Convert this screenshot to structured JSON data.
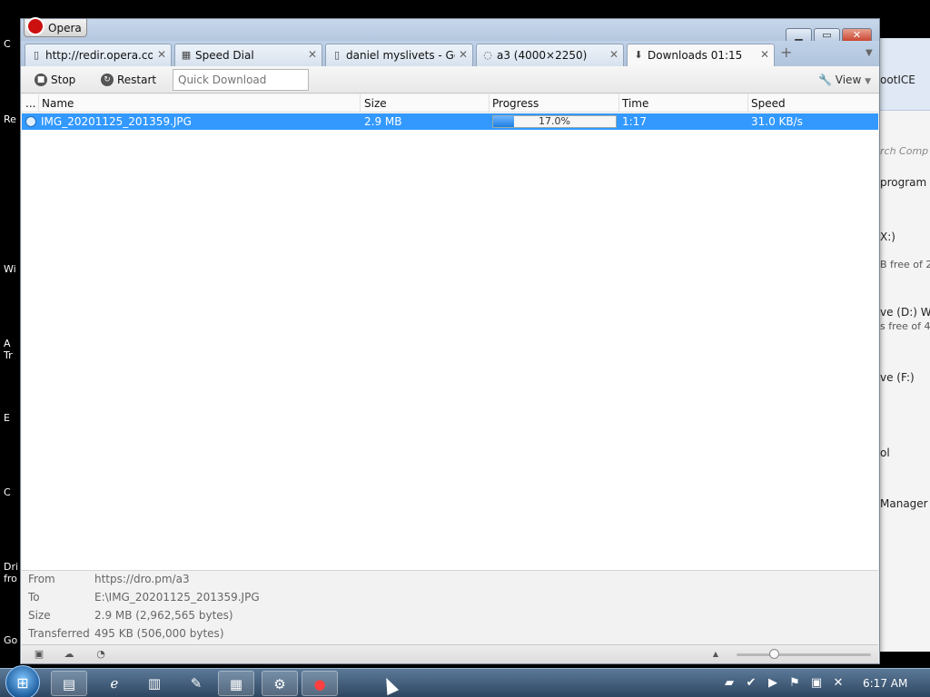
{
  "desktop": {
    "labels": [
      "C",
      "Re",
      "Wi",
      "A\nTr",
      "E",
      "C",
      "Dri\nfro",
      "Go"
    ]
  },
  "background_window": {
    "text1": "ootICE",
    "search_placeholder": "rch Comp",
    "program": "program",
    "drive1": "X:)",
    "drive1_free": "B free of 2",
    "drive2": "ve (D:) WI",
    "drive2_free": "s free of 46",
    "drive3": "ve (F:)",
    "item1": "ol",
    "item2": "Manager"
  },
  "window": {
    "app_name": "Opera",
    "colors": {
      "accent": "#3399ff",
      "close": "#c8402a"
    }
  },
  "tabs": [
    {
      "label": "http://redir.opera.co...",
      "icon": "page-icon"
    },
    {
      "label": "Speed Dial",
      "icon": "grid-icon"
    },
    {
      "label": "daniel myslivets - Go...",
      "icon": "page-icon"
    },
    {
      "label": "a3 (4000×2250)",
      "icon": "loading-icon"
    },
    {
      "label": "Downloads 01:15",
      "icon": "download-icon",
      "active": true
    }
  ],
  "toolbar": {
    "stop_label": "Stop",
    "restart_label": "Restart",
    "quick_download_placeholder": "Quick Download",
    "view_label": "View"
  },
  "columns": {
    "dots": "...",
    "name": "Name",
    "size": "Size",
    "progress": "Progress",
    "time": "Time",
    "speed": "Speed"
  },
  "downloads": [
    {
      "name": "IMG_20201125_201359.JPG",
      "size": "2.9 MB",
      "progress_text": "17.0%",
      "progress_fraction": 0.17,
      "time": "1:17",
      "speed": "31.0 KB/s"
    }
  ],
  "details": {
    "from_label": "From",
    "from_value": "https://dro.pm/a3",
    "to_label": "To",
    "to_value": "E:\\IMG_20201125_201359.JPG",
    "size_label": "Size",
    "size_value": "2.9 MB (2,962,565 bytes)",
    "transferred_label": "Transferred",
    "transferred_value": "495 KB (506,000 bytes)"
  },
  "taskbar": {
    "clock": "6:17 AM"
  }
}
